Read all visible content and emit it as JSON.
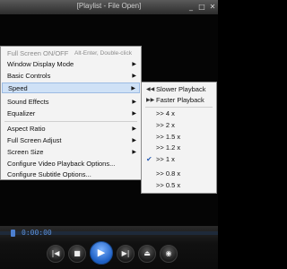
{
  "window": {
    "title": "[Playlist - File Open]",
    "minimize_icon": "_",
    "maximize_icon": "□",
    "close_icon": "✕"
  },
  "menu": {
    "items": [
      {
        "label": "Full Screen ON/OFF",
        "shortcut": "Alt-Enter, Double-click",
        "disabled": true
      },
      {
        "label": "Window Display Mode",
        "submenu": true
      },
      {
        "label": "Basic Controls",
        "submenu": true
      },
      {
        "label": "Speed",
        "submenu": true,
        "highlighted": true
      },
      {
        "label": "Sound Effects",
        "submenu": true
      },
      {
        "label": "Equalizer",
        "submenu": true
      },
      {
        "label": "Aspect Ratio",
        "submenu": true
      },
      {
        "label": "Full Screen Adjust",
        "submenu": true
      },
      {
        "label": "Screen Size",
        "submenu": true
      },
      {
        "label": "Configure Video Playback Options..."
      },
      {
        "label": "Configure Subtitle Options..."
      }
    ],
    "arrow_glyph": "▶"
  },
  "speed_submenu": {
    "items": [
      {
        "label": "Slower Playback",
        "icon": "slower-icon"
      },
      {
        "label": "Faster Playback",
        "icon": "faster-icon"
      },
      {
        "label": ">> 4 x"
      },
      {
        "label": ">> 2 x"
      },
      {
        "label": ">> 1.5 x"
      },
      {
        "label": ">> 1.2 x"
      },
      {
        "label": ">> 1 x",
        "checked": true
      },
      {
        "label": ">> 0.8 x"
      },
      {
        "label": ">> 0.5 x"
      }
    ],
    "slower_glyph": "◀◀",
    "faster_glyph": "▶▶",
    "check_glyph": "✔"
  },
  "player": {
    "time": "0:00:00",
    "prev_glyph": "|◀",
    "stop_glyph": "■",
    "play_glyph": "▶",
    "next_glyph": "▶|",
    "open_glyph": "⏏",
    "extra_glyph": "◉"
  },
  "colors": {
    "menu_highlight": "#cfe1f6",
    "accent": "#1d5fc4"
  }
}
